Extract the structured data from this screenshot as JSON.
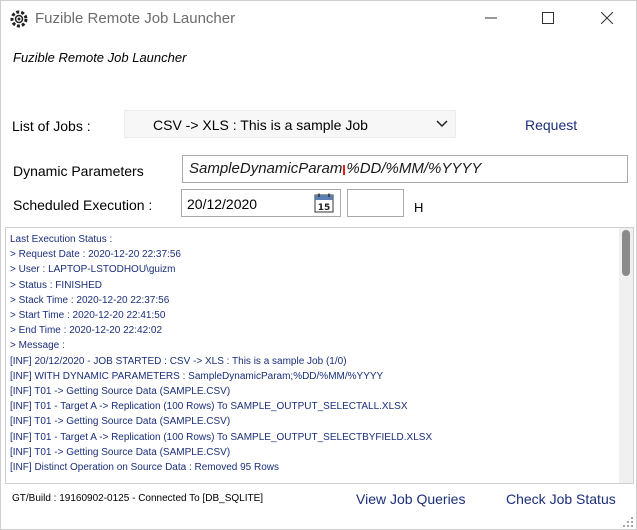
{
  "window": {
    "title": "Fuzible Remote Job Launcher",
    "icon": "app-gear-icon",
    "controls": {
      "minimize": "minimize-icon",
      "maximize": "maximize-icon",
      "close": "close-icon"
    }
  },
  "header": {
    "subtitle": "Fuzible Remote Job Launcher"
  },
  "jobs": {
    "label": "List of Jobs :",
    "selected": "CSV -> XLS : This is a sample Job",
    "request_label": "Request"
  },
  "dynamic_parameters": {
    "label": "Dynamic Parameters",
    "value_before_caret": "SampleDynamicParam",
    "value_after_caret": "%DD/%MM/%YYYY"
  },
  "schedule": {
    "label": "Scheduled Execution :",
    "date": "20/12/2020",
    "calendar_day": "15",
    "hour": "",
    "hour_unit": "H"
  },
  "log": {
    "lines": [
      "Last Execution Status :",
      "> Request Date : 2020-12-20 22:37:56",
      "> User : LAPTOP-LSTODHOU\\guizm",
      "> Status : FINISHED",
      "> Stack Time : 2020-12-20 22:37:56",
      "> Start Time : 2020-12-20 22:41:50",
      "> End Time : 2020-12-20 22:42:02",
      "> Message :",
      "[INF] 20/12/2020 - JOB STARTED : CSV -> XLS : This is a sample Job (1/0)",
      "[INF] WITH DYNAMIC PARAMETERS : SampleDynamicParam;%DD/%MM/%YYYY",
      "[INF] T01 -> Getting Source Data (SAMPLE.CSV)",
      "[INF] T01 - Target A -> Replication (100 Rows) To SAMPLE_OUTPUT_SELECTALL.XLSX",
      "[INF] T01 -> Getting Source Data (SAMPLE.CSV)",
      "[INF] T01 - Target A -> Replication (100 Rows) To SAMPLE_OUTPUT_SELECTBYFIELD.XLSX",
      "[INF] T01 -> Getting Source Data (SAMPLE.CSV)",
      "[INF] Distinct Operation on Source Data : Removed 95 Rows"
    ]
  },
  "footer": {
    "status": "GT/Build : 19160902-0125 - Connected To [DB_SQLITE]",
    "view_queries_label": "View Job Queries",
    "check_status_label": "Check Job Status"
  },
  "colors": {
    "link": "#1b2f7a",
    "log_text": "#1b2f7a",
    "caret": "#e02020"
  }
}
